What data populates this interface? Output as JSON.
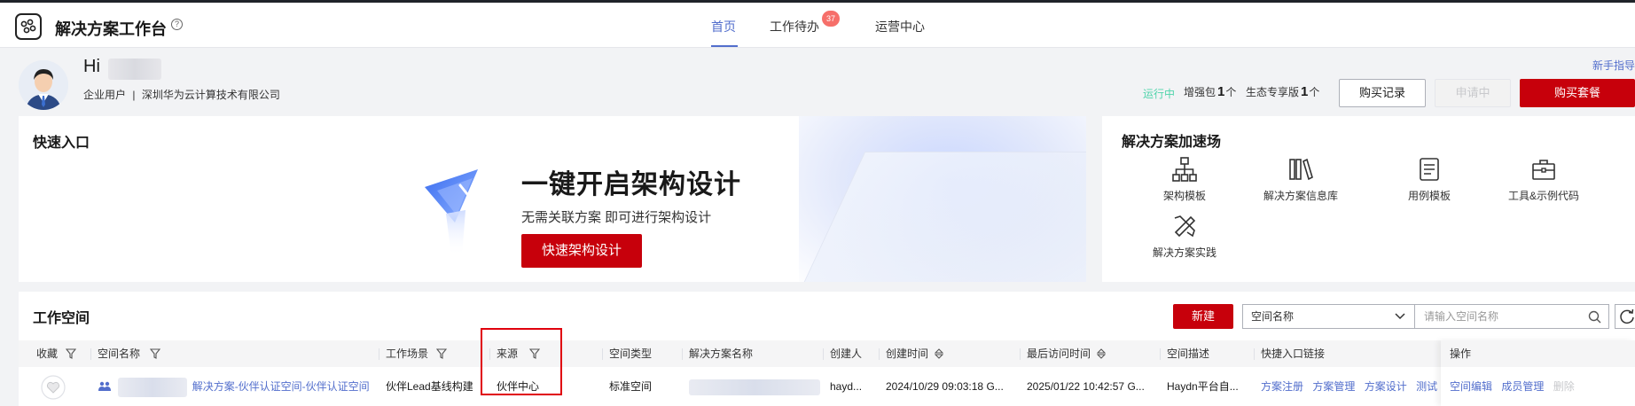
{
  "header": {
    "app_title": "解决方案工作台",
    "tabs": [
      {
        "label": "首页",
        "active": true
      },
      {
        "label": "工作待办",
        "badge": "37"
      },
      {
        "label": "运营中心"
      }
    ]
  },
  "profile": {
    "greeting": "Hi",
    "user_type": "企业用户",
    "divider": "|",
    "company": "深圳华为云计算技术有限公司",
    "guide_link": "新手指导",
    "status": "运行中",
    "stats": [
      {
        "label": "增强包",
        "count": "1",
        "unit": "个"
      },
      {
        "label": "生态专享版",
        "count": "1",
        "unit": "个"
      }
    ],
    "buttons": {
      "purchase_record": "购买记录",
      "applying": "申请中",
      "buy_package": "购买套餐"
    }
  },
  "quick_entry": {
    "title": "快速入口",
    "headline": "一键开启架构设计",
    "subtitle": "无需关联方案 即可进行架构设计",
    "button": "快速架构设计"
  },
  "accelerator": {
    "title": "解决方案加速场",
    "items": [
      {
        "label": "架构模板",
        "icon": "hierarchy-icon"
      },
      {
        "label": "解决方案信息库",
        "icon": "library-icon"
      },
      {
        "label": "用例模板",
        "icon": "document-list-icon"
      },
      {
        "label": "工具&示例代码",
        "icon": "toolbox-icon"
      },
      {
        "label": "解决方案实践",
        "icon": "tools-icon"
      }
    ]
  },
  "workspace": {
    "title": "工作空间",
    "new_button": "新建",
    "select_value": "空间名称",
    "search_placeholder": "请输入空间名称",
    "columns": [
      "收藏",
      "空间名称",
      "工作场景",
      "来源",
      "空间类型",
      "解决方案名称",
      "创建人",
      "创建时间",
      "最后访问时间",
      "空间描述",
      "快捷入口链接",
      "操作"
    ],
    "rows": [
      {
        "space_name": "解决方案-伙伴认证空间-伙伴认证空间",
        "scenario": "伙伴Lead基线构建",
        "source": "伙伴中心",
        "space_type": "标准空间",
        "creator": "hayd...",
        "created": "2024/10/29 09:03:18 G...",
        "last_visit": "2025/01/22 10:42:57 G...",
        "description": "Haydn平台自...",
        "quick_links": [
          "方案注册",
          "方案管理",
          "方案设计",
          "测试"
        ],
        "actions": [
          "空间编辑",
          "成员管理",
          "删除"
        ]
      }
    ]
  },
  "colors": {
    "brand_red": "#c7000b",
    "link_blue": "#526ecc",
    "status_green": "#50d4ab",
    "highlight_red": "#e0000d"
  }
}
